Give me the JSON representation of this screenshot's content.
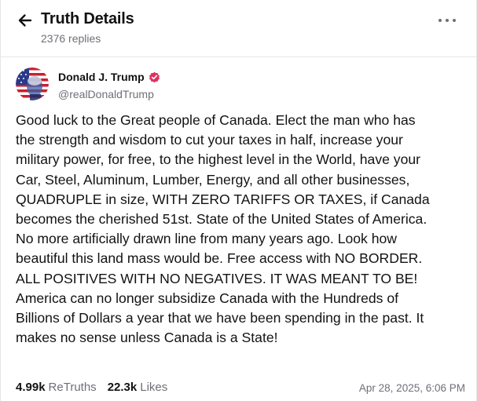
{
  "header": {
    "title": "Truth Details",
    "replies": "2376 replies",
    "back_icon": "arrow-left-icon",
    "more_icon": "more-horizontal-icon"
  },
  "post": {
    "author_name": "Donald J. Trump",
    "author_handle": "@realDonaldTrump",
    "verified_icon": "verified-badge-icon",
    "body_lines": [
      "Good luck to the Great people of Canada. Elect the man who has",
      "the strength and wisdom to cut your taxes in half, increase your",
      "military power, for free, to the highest level in the World, have your",
      "Car, Steel, Aluminum, Lumber, Energy, and all other businesses,",
      "QUADRUPLE in size, WITH ZERO TARIFFS OR TAXES, if Canada",
      "becomes the cherished 51st. State of the United States of America.",
      "No more artificially drawn line from many years ago. Look how",
      "beautiful this land mass would be. Free access with NO BORDER.",
      "ALL POSITIVES WITH NO NEGATIVES. IT WAS MEANT TO BE!",
      "America can no longer subsidize Canada with the Hundreds of",
      "Billions of Dollars a year that we have been spending in the past. It",
      "makes no sense unless Canada is a State!"
    ],
    "retruths_count": "4.99k",
    "retruths_label": "ReTruths",
    "likes_count": "22.3k",
    "likes_label": "Likes",
    "timestamp": "Apr 28, 2025, 6:06 PM"
  },
  "colors": {
    "text": "#121212",
    "muted": "#6f6f78",
    "border": "#e6e6e9",
    "verified": "#e0315e"
  }
}
